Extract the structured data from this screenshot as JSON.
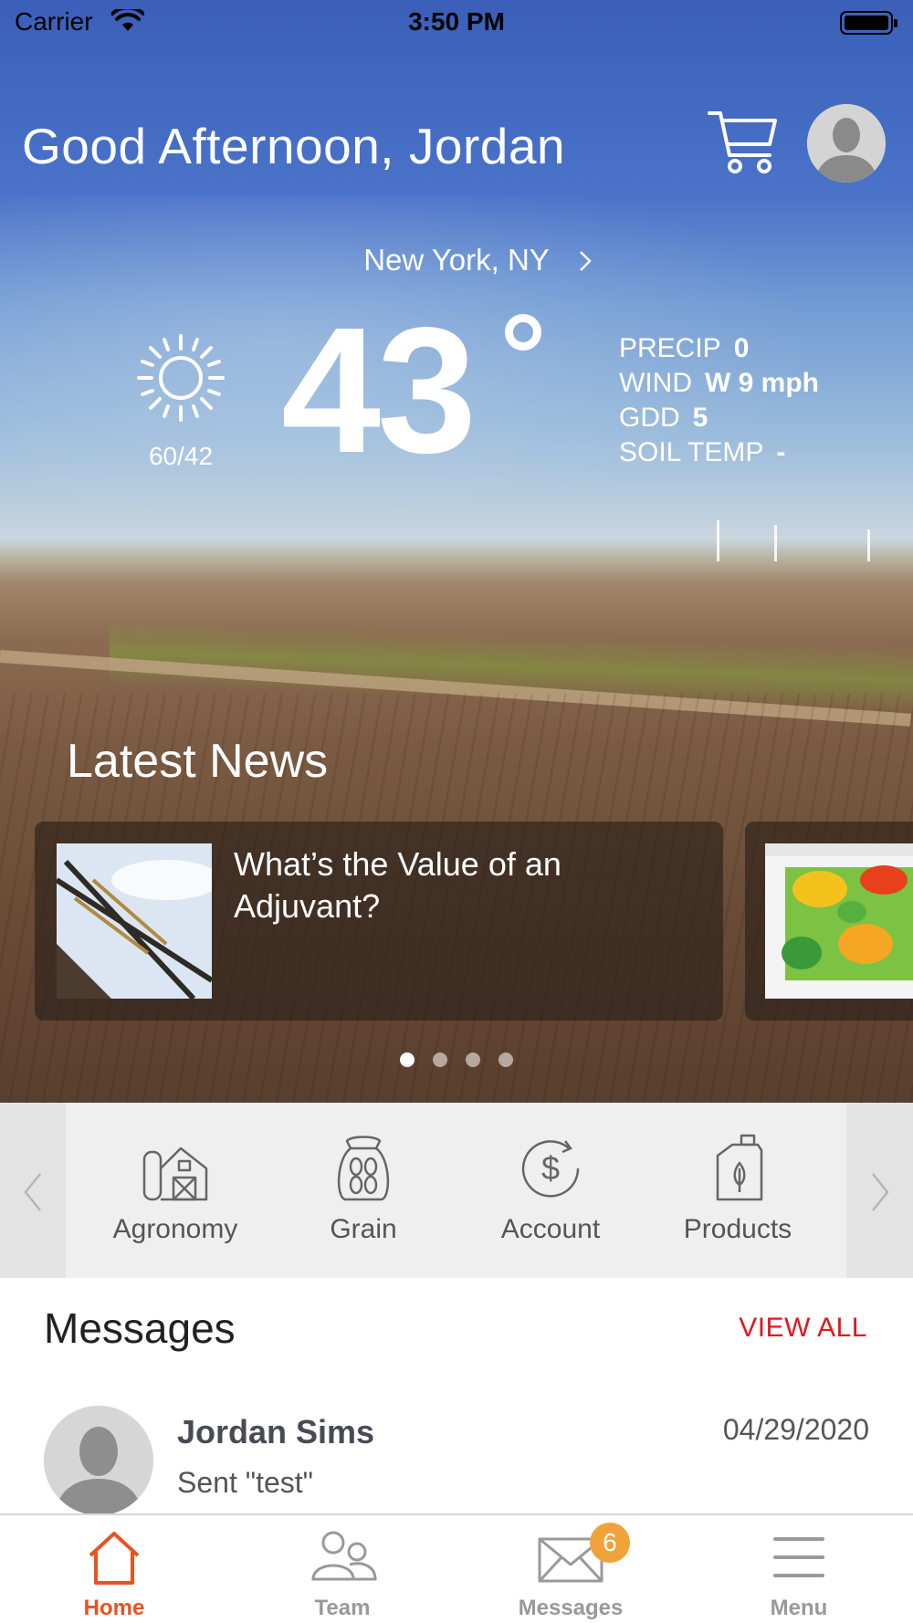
{
  "status_bar": {
    "carrier": "Carrier",
    "time": "3:50 PM"
  },
  "header": {
    "greeting": "Good Afternoon, Jordan"
  },
  "weather": {
    "location": "New York, NY",
    "temperature": "43",
    "hi_lo": "60/42",
    "condition_icon": "sun-icon",
    "stats": [
      {
        "label": "PRECIP",
        "value": "0"
      },
      {
        "label": "WIND",
        "value": "W 9 mph"
      },
      {
        "label": "GDD",
        "value": "5"
      },
      {
        "label": "SOIL TEMP",
        "value": "-"
      }
    ]
  },
  "news": {
    "title": "Latest News",
    "cards": [
      {
        "headline": "What’s the Value of an Adjuvant?"
      }
    ],
    "page_count": 4,
    "active_page": 1
  },
  "quick_links": [
    {
      "label": "Agronomy",
      "icon": "barn-icon"
    },
    {
      "label": "Grain",
      "icon": "grain-bag-icon"
    },
    {
      "label": "Account",
      "icon": "dollar-icon"
    },
    {
      "label": "Products",
      "icon": "jug-icon"
    }
  ],
  "messages": {
    "title": "Messages",
    "view_all": "VIEW ALL",
    "items": [
      {
        "name": "Jordan Sims",
        "preview": "Sent \"test\"",
        "date": "04/29/2020"
      }
    ]
  },
  "tab_bar": {
    "tabs": [
      {
        "label": "Home",
        "icon": "home-icon",
        "active": true
      },
      {
        "label": "Team",
        "icon": "team-icon",
        "active": false
      },
      {
        "label": "Messages",
        "icon": "mail-icon",
        "active": false,
        "badge": "6"
      },
      {
        "label": "Menu",
        "icon": "menu-icon",
        "active": false
      }
    ]
  },
  "colors": {
    "header_blue": "#3b5fb8",
    "accent_orange": "#e8531f",
    "view_all_red": "#e4151f",
    "badge_orange": "#f0a33a"
  }
}
